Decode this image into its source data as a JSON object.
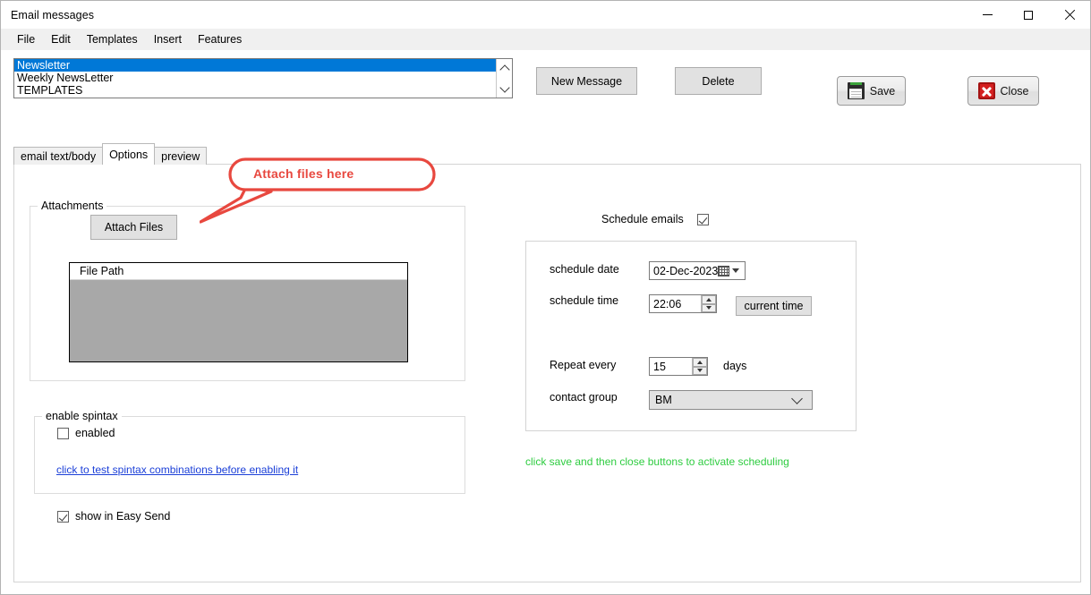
{
  "window": {
    "title": "Email messages",
    "controls": {
      "minimize": "minimize",
      "maximize": "maximize",
      "close": "close"
    }
  },
  "menubar": {
    "items": [
      {
        "label": "File"
      },
      {
        "label": "Edit"
      },
      {
        "label": "Templates"
      },
      {
        "label": "Insert"
      },
      {
        "label": "Features"
      }
    ]
  },
  "template_list": {
    "items": [
      {
        "label": "Newsletter",
        "selected": true
      },
      {
        "label": "Weekly NewsLetter",
        "selected": false
      },
      {
        "label": "TEMPLATES",
        "selected": false
      }
    ],
    "scroll_up_icon": "chevron-up-icon",
    "scroll_down_icon": "chevron-down-icon"
  },
  "toolbar": {
    "new_message_label": "New Message",
    "delete_label": "Delete",
    "save_label": "Save",
    "close_label": "Close",
    "save_icon": "floppy-disk-icon",
    "close_icon": "red-x-icon"
  },
  "tabs": [
    {
      "label": "email text/body",
      "active": false
    },
    {
      "label": "Options",
      "active": true
    },
    {
      "label": "preview",
      "active": false
    }
  ],
  "callout": {
    "text": "Attach files here",
    "color": "#e8483f"
  },
  "attachments": {
    "group_title": "Attachments",
    "attach_button_label": "Attach Files",
    "file_list": {
      "column_header": "File Path",
      "rows": []
    }
  },
  "spintax": {
    "group_title": "enable spintax",
    "enabled_label": "enabled",
    "enabled_checked": false,
    "link_label": "click to test spintax combinations before enabling it",
    "link_color": "#1c40d8"
  },
  "easy_send": {
    "label": "show in Easy Send",
    "checked": true
  },
  "schedule": {
    "toggle_label": "Schedule emails",
    "toggle_checked": true,
    "date_label": "schedule date",
    "date_value": "02-Dec-2023",
    "date_icon": "calendar-icon",
    "time_label": "schedule time",
    "time_value": "22:06",
    "current_time_button": "current time",
    "repeat_label": "Repeat every",
    "repeat_value": "15",
    "repeat_unit": "days",
    "contact_group_label": "contact group",
    "contact_group_value": "BM",
    "hint": "click save and then close buttons to activate scheduling",
    "hint_color": "#2ecc40"
  }
}
